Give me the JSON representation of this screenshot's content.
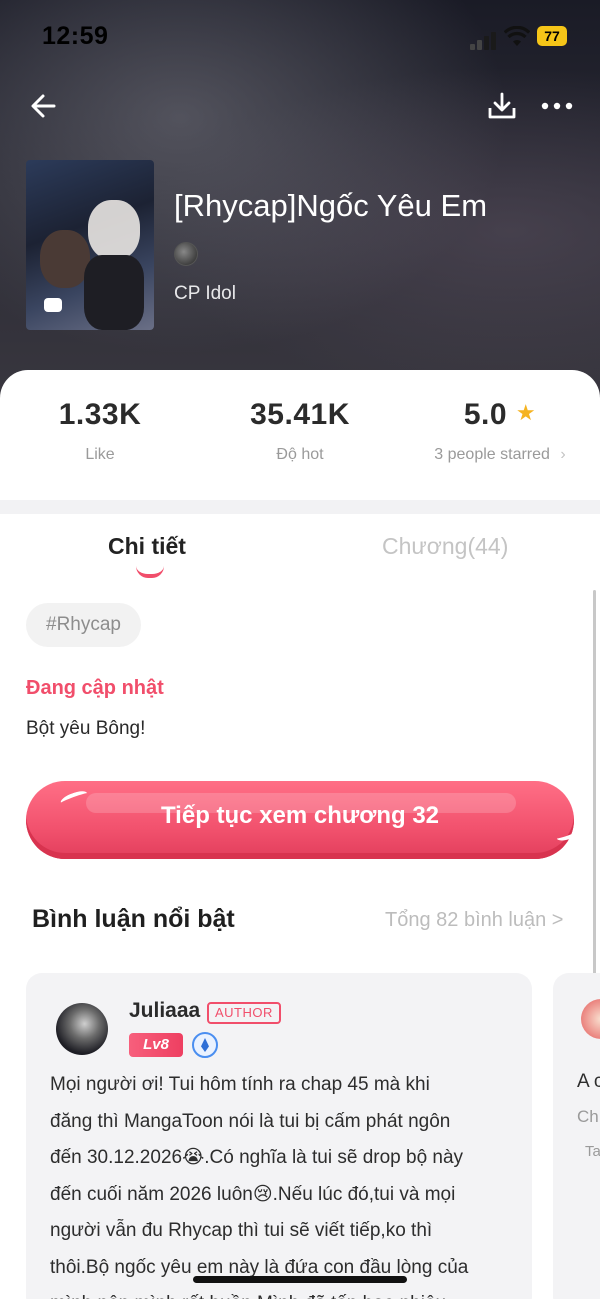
{
  "status_bar": {
    "time": "12:59",
    "battery": "77"
  },
  "header": {
    "back_icon": "arrow-left-icon",
    "download_icon": "download-icon",
    "more_icon": "more-horizontal-icon"
  },
  "comic": {
    "title": "[Rhycap]Ngốc Yêu Em",
    "category": "CP Idol"
  },
  "stats": {
    "likes": {
      "value": "1.33K",
      "label": "Like"
    },
    "hot": {
      "value": "35.41K",
      "label": "Độ hot"
    },
    "rating": {
      "value": "5.0",
      "label": "3 people starred",
      "chevron": "›"
    }
  },
  "tabs": {
    "detail": "Chi tiết",
    "chapters": "Chương(44)"
  },
  "detail": {
    "tag": "#Rhycap",
    "update_status": "Đang cập nhật",
    "description": "Bột yêu Bông!",
    "continue_button": "Tiếp tục xem chương 32"
  },
  "comments": {
    "section_title": "Bình luận nổi bật",
    "total": "Tổng 82 bình luận >",
    "items": [
      {
        "name": "Juliaaa",
        "badge": "AUTHOR",
        "level": "Lv8",
        "text_lines": [
          "Mọi người ơi! Tui hôm tính ra chap 45 mà khi",
          "đăng thì MangaToon nói là tui bị cấm phát ngôn",
          "đến 30.12.2026😭.Có nghĩa là tui sẽ drop bộ này",
          "đến cuối năm 2026 luôn😢.Nếu lúc đó,tui và mọi",
          "người vẫn đu Rhycap thì tui sẽ viết tiếp,ko thì",
          "thôi.Bộ ngốc yêu em này là đứa con đầu lòng của",
          "mình nên mình rất buồn.Mình đã tốn bao nhiêu"
        ]
      }
    ],
    "next_preview": {
      "line1": "A c",
      "line2": "Ch",
      "line3": "Ta"
    }
  }
}
